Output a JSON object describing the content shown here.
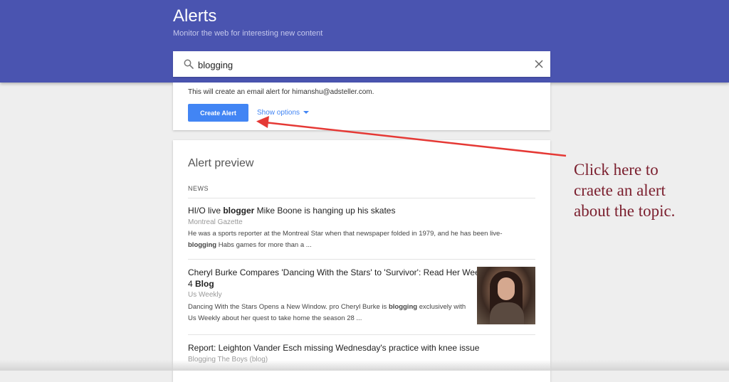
{
  "header": {
    "title": "Alerts",
    "subtitle": "Monitor the web for interesting new content"
  },
  "search": {
    "value": "blogging",
    "icon": "search-icon",
    "clear_icon": "close-icon"
  },
  "create": {
    "email_note": "This will create an email alert for himanshu@adsteller.com.",
    "button_label": "Create Alert",
    "show_options_label": "Show options"
  },
  "preview": {
    "title": "Alert preview",
    "section": "NEWS",
    "results": [
      {
        "title_parts": [
          "HI/O live ",
          "blogger",
          " Mike Boone is hanging up his skates"
        ],
        "source": "Montreal Gazette",
        "snippet_line1": "He was a sports reporter at the Montreal Star when that newspaper folded in 1979, and he has been live-",
        "snippet_line2_parts": [
          "blogging",
          " Habs games for more than a ..."
        ]
      },
      {
        "title_line1": "Cheryl Burke Compares 'Dancing With the Stars' to 'Survivor': Read Her Week",
        "title_line2_parts": [
          "4 ",
          "Blog"
        ],
        "source": "Us Weekly",
        "snippet_line1_parts": [
          "Dancing With the Stars Opens a New Window. pro Cheryl Burke is ",
          "blogging",
          " exclusively with"
        ],
        "snippet_line2": "Us Weekly about her quest to take home the season 28 ..."
      },
      {
        "title": "Report: Leighton Vander Esch missing Wednesday's practice with knee issue",
        "source": "Blogging The Boys (blog)"
      }
    ]
  },
  "annotation": {
    "line1": "Click here to",
    "line2": "craete an alert",
    "line3": "about the topic."
  },
  "colors": {
    "header_bg": "#4a54b0",
    "accent_blue": "#4285f4",
    "arrow_red": "#e53935",
    "annotation_text": "#7b1f2e"
  }
}
